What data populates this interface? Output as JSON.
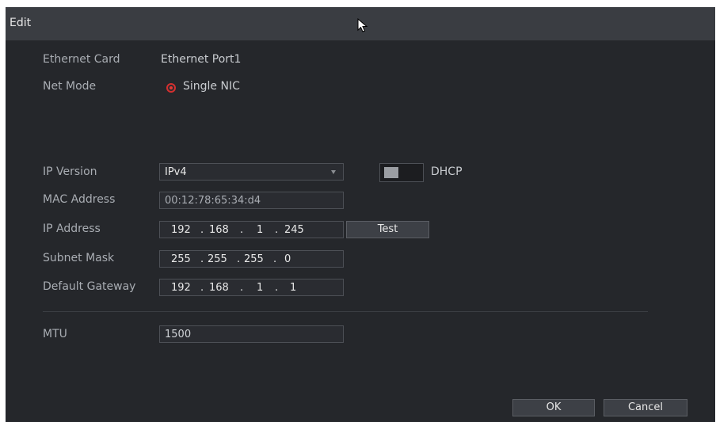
{
  "dialog": {
    "title": "Edit"
  },
  "ethernet_card": {
    "label": "Ethernet Card",
    "value": "Ethernet Port1"
  },
  "net_mode": {
    "label": "Net Mode",
    "option": "Single NIC"
  },
  "ip_version": {
    "label": "IP Version",
    "value": "IPv4"
  },
  "dhcp": {
    "label": "DHCP"
  },
  "mac_address": {
    "label": "MAC Address",
    "value": "00:12:78:65:34:d4"
  },
  "ip_address": {
    "label": "IP Address",
    "octets": [
      "192",
      "168",
      "1",
      "245"
    ]
  },
  "test_button": {
    "label": "Test"
  },
  "subnet_mask": {
    "label": "Subnet Mask",
    "octets": [
      "255",
      "255",
      "255",
      "0"
    ]
  },
  "default_gateway": {
    "label": "Default Gateway",
    "octets": [
      "192",
      "168",
      "1",
      "1"
    ]
  },
  "mtu": {
    "label": "MTU",
    "value": "1500"
  },
  "buttons": {
    "ok": "OK",
    "cancel": "Cancel"
  },
  "ip_separator": "."
}
